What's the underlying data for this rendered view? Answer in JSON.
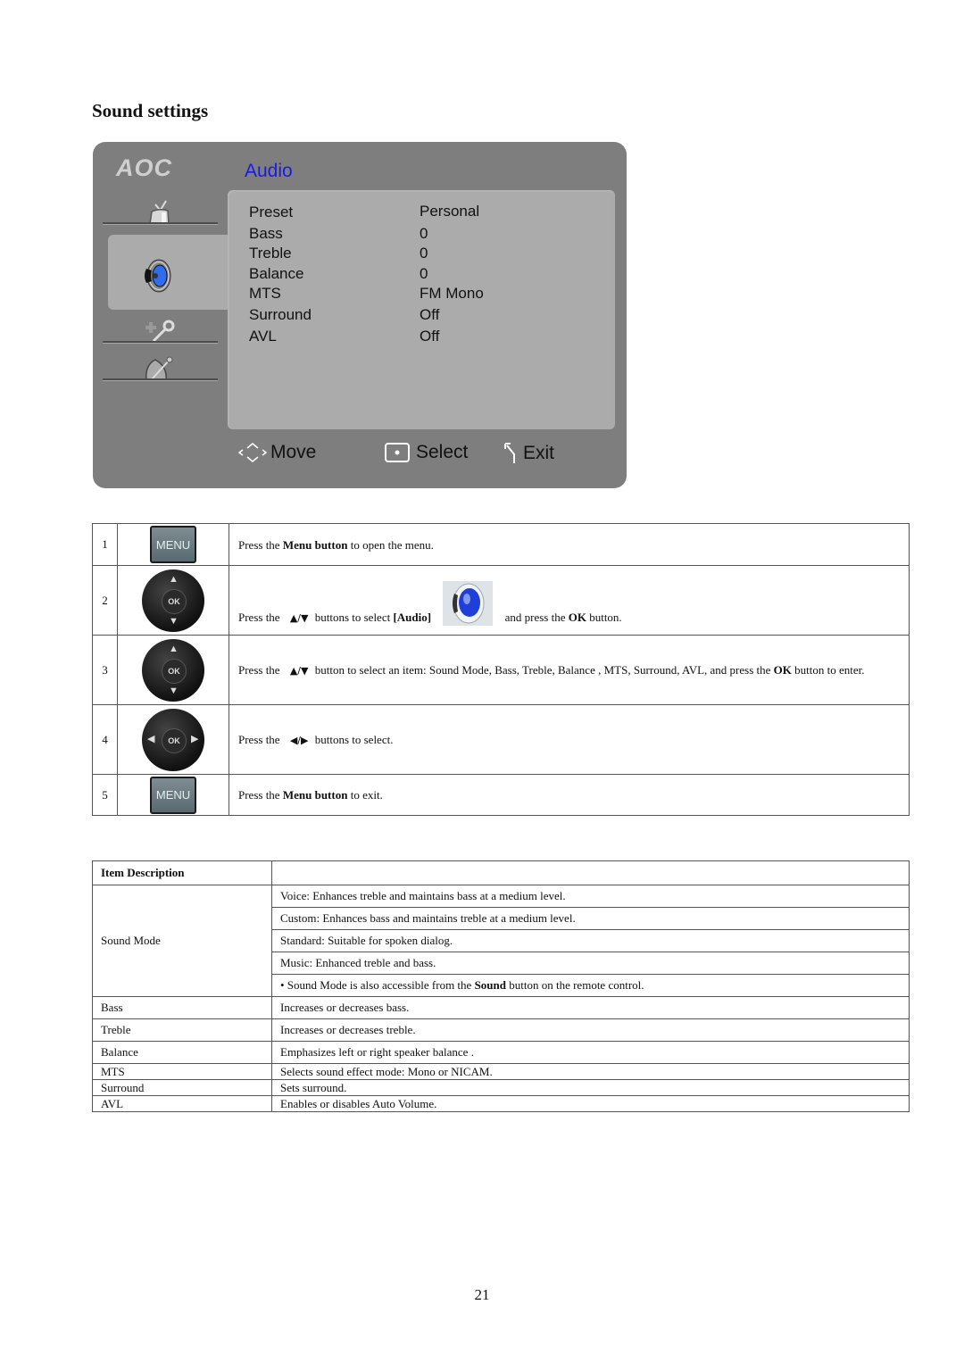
{
  "page": {
    "title": "Sound settings",
    "page_number": "21"
  },
  "osd": {
    "brand": "AOC",
    "menu_title": "Audio",
    "nav_icons": [
      "tv-icon",
      "speaker-icon",
      "tools-icon",
      "satellite-icon"
    ],
    "selected_nav": "speaker-icon",
    "items": [
      {
        "label": "Preset",
        "value": "Personal"
      },
      {
        "label": "Bass",
        "value": "0"
      },
      {
        "label": "Treble",
        "value": "0"
      },
      {
        "label": "Balance",
        "value": "0"
      },
      {
        "label": "MTS",
        "value": "FM Mono"
      },
      {
        "label": "Surround",
        "value": "Off"
      },
      {
        "label": "AVL",
        "value": "Off"
      }
    ],
    "footer": {
      "move": "Move",
      "select": "Select",
      "exit": "Exit"
    },
    "colors": {
      "background": "#7e7e7e",
      "panel": "#ababab",
      "title": "#1a1ae8",
      "speaker_accent": "#2f6cf0"
    }
  },
  "steps": [
    {
      "num": "1",
      "button": "MENU",
      "pre": "Press the ",
      "bold": "Menu button",
      "post": " to open the menu."
    },
    {
      "num": "2",
      "pre": "Press the ",
      "arrows": "▲/▼",
      "mid": " buttons to select ",
      "bold": "[Audio]",
      "post1": "and press the ",
      "bold2": "OK",
      "post2": " button."
    },
    {
      "num": "3",
      "pre": "Press the ",
      "arrows": "▲/▼",
      "mid": " button to select an item: Sound Mode, Bass, Treble, Balance , MTS, Surround, AVL, and press the ",
      "bold": "OK",
      "post": " button to enter."
    },
    {
      "num": "4",
      "pre": "Press the ",
      "arrows": "◀/▶",
      "post": " buttons to select."
    },
    {
      "num": "5",
      "button": "MENU",
      "pre": "Press the ",
      "bold": "Menu button",
      "post": " to exit."
    }
  ],
  "remote": {
    "ok_label": "OK"
  },
  "description_table": {
    "header": "Item Description",
    "sound_mode": {
      "label": "Sound Mode",
      "lines": [
        "Voice: Enhances treble and maintains bass at a medium level.",
        "Custom: Enhances bass and maintains treble at a medium level.",
        "Standard: Suitable for spoken dialog.",
        "Music: Enhanced treble and bass."
      ],
      "note_pre": "• Sound Mode is also accessible from the ",
      "note_bold": "Sound",
      "note_post": " button on the remote control."
    },
    "rows": [
      {
        "item": "Bass",
        "desc": "Increases or decreases bass."
      },
      {
        "item": "Treble",
        "desc": "Increases or decreases treble."
      },
      {
        "item": "Balance",
        "desc": "Emphasizes left or right speaker balance ."
      },
      {
        "item": "MTS",
        "desc": "Selects sound effect mode: Mono or NICAM."
      },
      {
        "item": "Surround",
        "desc": "Sets surround."
      },
      {
        "item": "AVL",
        "desc": "Enables or disables Auto Volume."
      }
    ]
  }
}
